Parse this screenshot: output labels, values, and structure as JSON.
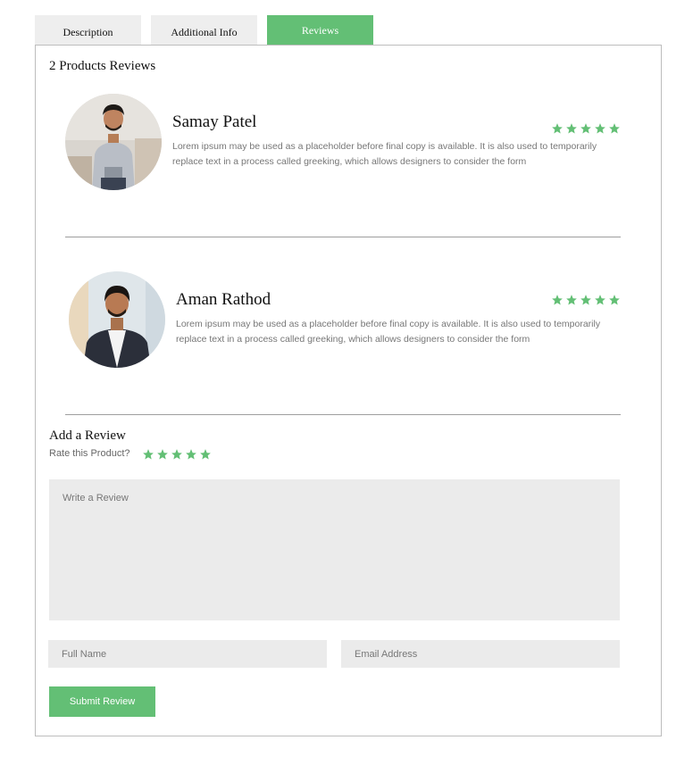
{
  "tabs": [
    {
      "label": "Description",
      "active": false
    },
    {
      "label": "Additional Info",
      "active": false
    },
    {
      "label": "Reviews",
      "active": true
    }
  ],
  "reviews_heading": "2 Products Reviews",
  "reviews": [
    {
      "name": "Samay Patel",
      "text": "Lorem ipsum may be used as a placeholder before final copy is available. It is also used to temporarily replace text in a process called greeking, which allows designers to consider the form",
      "rating": 5
    },
    {
      "name": "Aman Rathod",
      "text": "Lorem ipsum may be used as a placeholder before final copy is available. It is also used to temporarily replace text in a process called greeking, which allows designers to consider the form",
      "rating": 5
    }
  ],
  "add_review": {
    "title": "Add a Review",
    "rate_label": "Rate this Product?",
    "rate_stars": 5,
    "review_placeholder": "Write a Review",
    "name_placeholder": "Full Name",
    "email_placeholder": "Email Address",
    "submit_label": "Submit Review"
  },
  "colors": {
    "accent": "#63bf75",
    "input_bg": "#ebebeb",
    "tab_bg": "#eeeeee"
  },
  "icons": {
    "star": "star-icon",
    "avatar": "user-photo"
  }
}
